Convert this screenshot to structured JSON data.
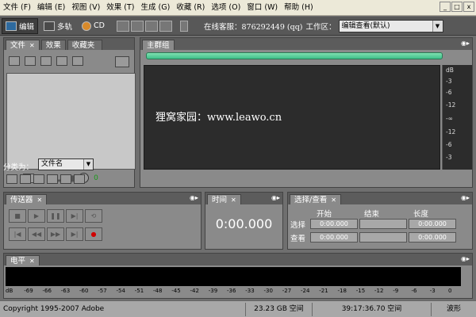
{
  "menu": [
    "文件 (F)",
    "编辑 (E)",
    "视图 (V)",
    "效果 (T)",
    "生成 (G)",
    "收藏 (R)",
    "选项 (O)",
    "窗口 (W)",
    "帮助 (H)"
  ],
  "window_controls": [
    "_",
    "□",
    "x"
  ],
  "toolbar": {
    "edit_label": "编辑",
    "multitrack_label": "多轨",
    "cd_label": "CD",
    "support_text": "在线客服：876292449 (qq)",
    "workspace_label": "工作区：",
    "workspace_value": "编辑查看(默认)"
  },
  "files_panel": {
    "tabs": [
      "文件",
      "效果",
      "收藏夹"
    ],
    "sortby_label": "分类为：",
    "sortby_value": "文件名",
    "volume_value": "0"
  },
  "main_panel": {
    "tab": "主群组",
    "watermark": "狸窝家园：www.leawo.cn",
    "db_scale": [
      "dB",
      "-3",
      "-6",
      "-12",
      "-∞",
      "-12",
      "-6",
      "-3"
    ]
  },
  "transport_panel": {
    "tab": "传送器"
  },
  "time_panel": {
    "tab": "时间",
    "time": "0:00.000"
  },
  "selview_panel": {
    "tab": "选择/查看",
    "columns": [
      "开始",
      "结束",
      "长度"
    ],
    "rows": [
      {
        "label": "选择",
        "start": "0:00.000",
        "end": "",
        "length": "0:00.000"
      },
      {
        "label": "查看",
        "start": "0:00.000",
        "end": "",
        "length": "0:00.000"
      }
    ]
  },
  "level_panel": {
    "tab": "电平",
    "scale": [
      "dB",
      "-69",
      "-66",
      "-63",
      "-60",
      "-57",
      "-54",
      "-51",
      "-48",
      "-45",
      "-42",
      "-39",
      "-36",
      "-33",
      "-30",
      "-27",
      "-24",
      "-21",
      "-18",
      "-15",
      "-12",
      "-9",
      "-6",
      "-3",
      "0"
    ]
  },
  "statusbar": {
    "copyright": "Copyright 1995-2007 Adobe",
    "disk_space": "23.23 GB 空间",
    "time_space": "39:17:36.70 空间",
    "mode": "波形"
  }
}
